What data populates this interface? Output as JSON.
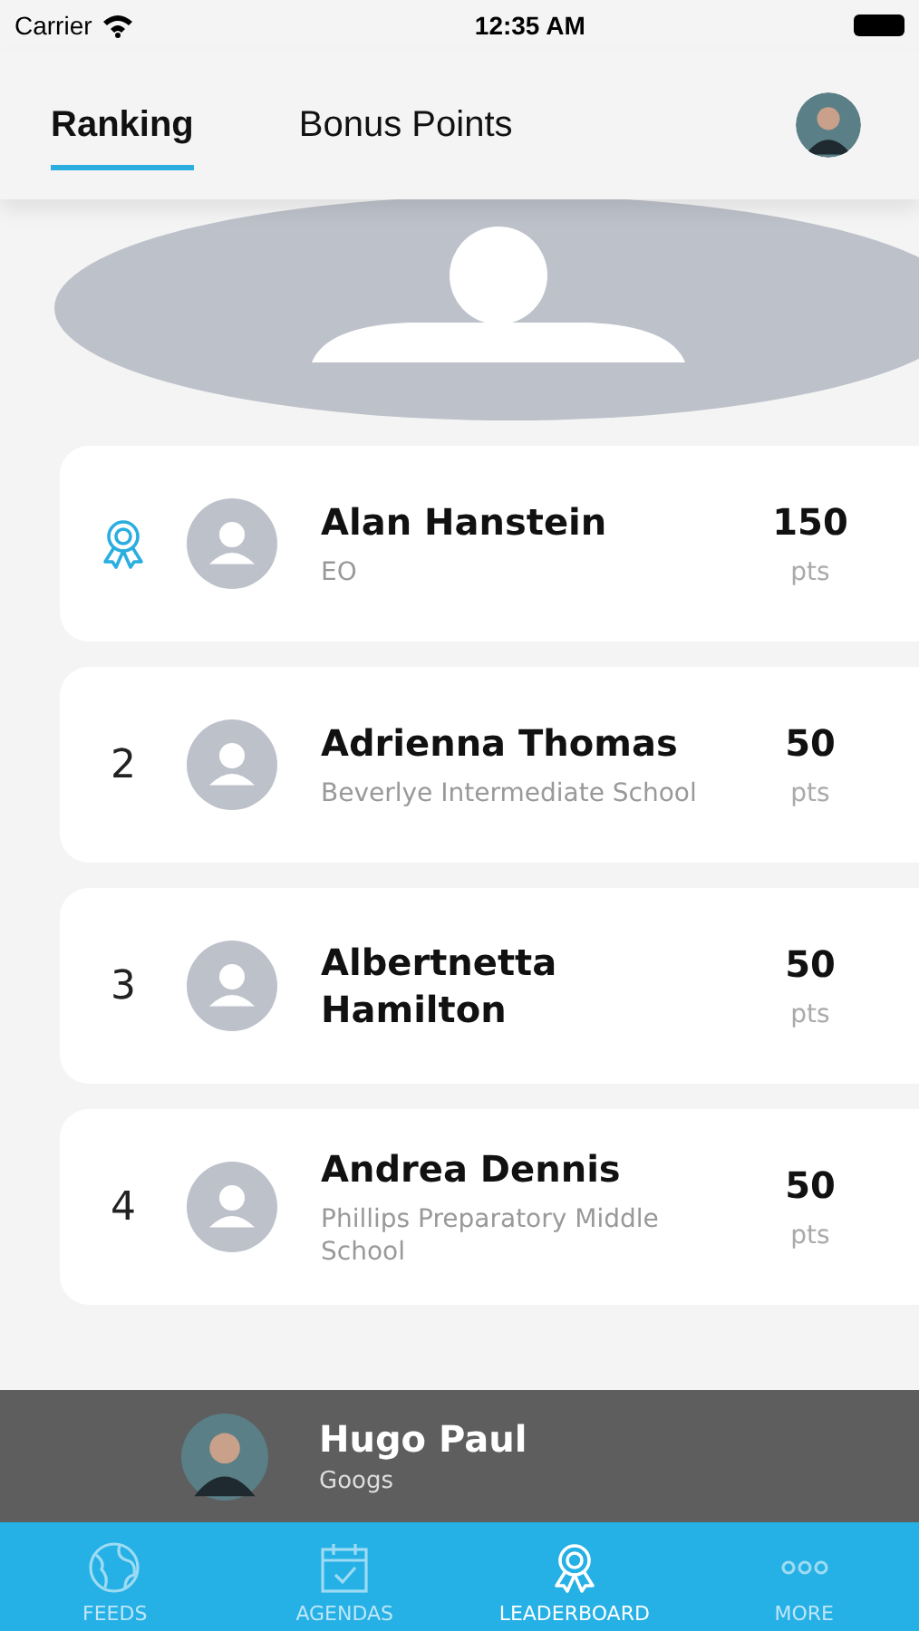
{
  "status_bar": {
    "carrier": "Carrier",
    "time": "12:35 AM"
  },
  "tabs": [
    {
      "label": "Ranking",
      "selected": true
    },
    {
      "label": "Bonus Points",
      "selected": false
    }
  ],
  "ranking": [
    {
      "kind": "award",
      "name": "Alan Hanstein",
      "subtitle": "EO",
      "points": "150",
      "unit": "pts"
    },
    {
      "kind": "number",
      "rank": "2",
      "name": "Adrienna Thomas",
      "subtitle": "Beverlye Intermediate School",
      "points": "50",
      "unit": "pts"
    },
    {
      "kind": "number",
      "rank": "3",
      "name": "Albertnetta Hamilton",
      "points": "50",
      "unit": "pts"
    },
    {
      "kind": "number",
      "rank": "4",
      "name": "Andrea Dennis",
      "subtitle": "Phillips Preparatory Middle School",
      "points": "50",
      "unit": "pts"
    }
  ],
  "current_user": {
    "name": "Hugo Paul",
    "subtitle": "Googs"
  },
  "tab_bar": [
    {
      "label": "FEEDS",
      "kind": "globe",
      "selected": false
    },
    {
      "label": "AGENDAS",
      "kind": "calendar",
      "selected": false
    },
    {
      "label": "LEADERBOARD",
      "kind": "award",
      "selected": true
    },
    {
      "label": "MORE",
      "kind": "dots",
      "selected": false
    }
  ]
}
